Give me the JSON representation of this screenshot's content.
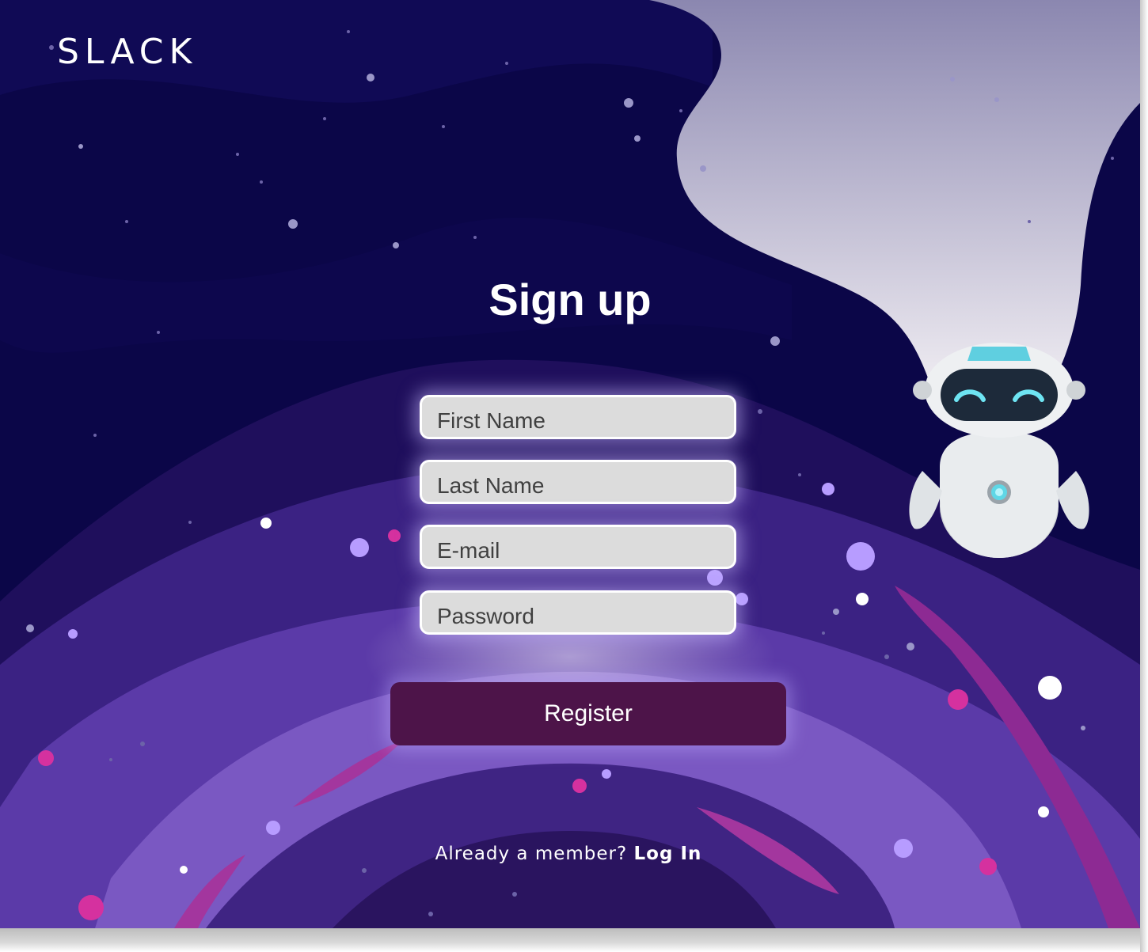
{
  "brand": {
    "logo_text": "SLACK"
  },
  "form": {
    "title": "Sign up",
    "fields": [
      {
        "placeholder": "First Name",
        "value": ""
      },
      {
        "placeholder": "Last Name",
        "value": ""
      },
      {
        "placeholder": "E-mail",
        "value": ""
      },
      {
        "placeholder": "Password",
        "value": ""
      }
    ],
    "submit_label": "Register"
  },
  "footer": {
    "prompt": "Already a member?",
    "link_label": "Log In"
  },
  "colors": {
    "background": "#0b0648",
    "button": "#4d1449",
    "field_background": "#dcdcdc"
  },
  "illustration": {
    "name": "space-robot-illustration"
  }
}
